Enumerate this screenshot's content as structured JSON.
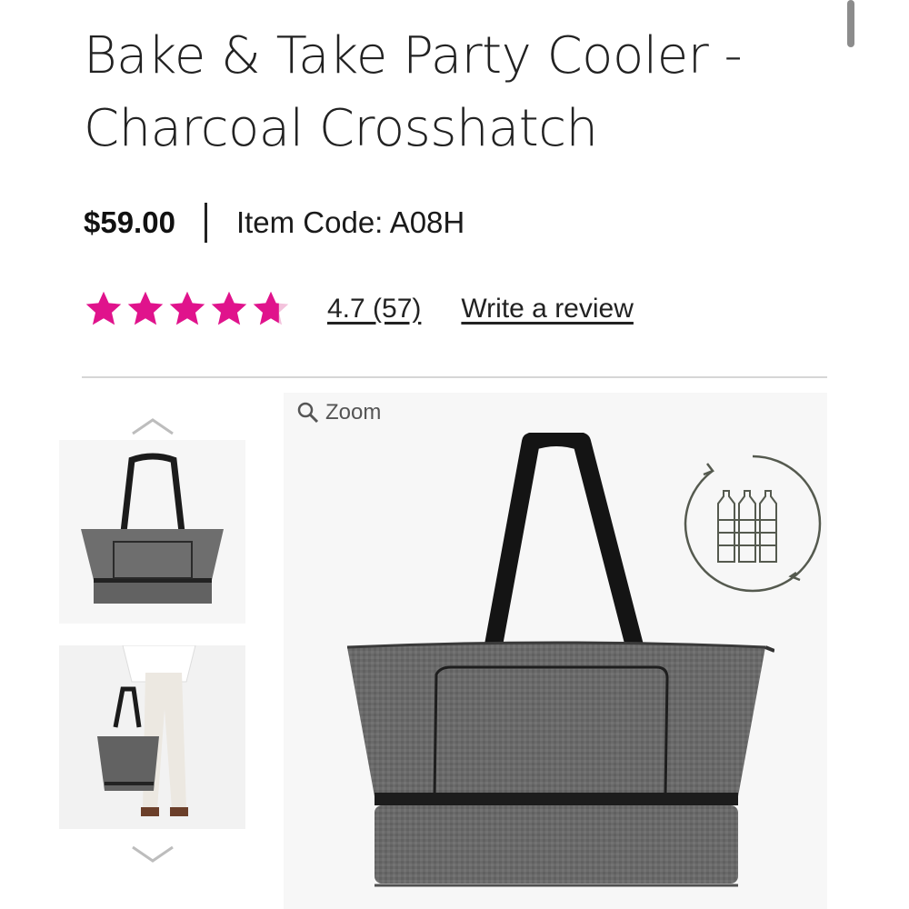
{
  "product": {
    "title_line1": "Bake & Take Party Cooler -",
    "title_line2": "Charcoal Crosshatch",
    "price": "$59.00",
    "item_code": "Item Code: A08H"
  },
  "rating": {
    "stars": 4.7,
    "score_text": "4.7 (57)",
    "write_review": "Write a review",
    "star_color": "#e0138c"
  },
  "gallery": {
    "zoom_label": "Zoom",
    "thumbnails": [
      "bag-product-thumbnail",
      "person-holding-bag-thumbnail"
    ],
    "up_icon": "chevron-up-icon",
    "down_icon": "chevron-down-icon",
    "badge_icon": "recycled-bottles-icon"
  }
}
